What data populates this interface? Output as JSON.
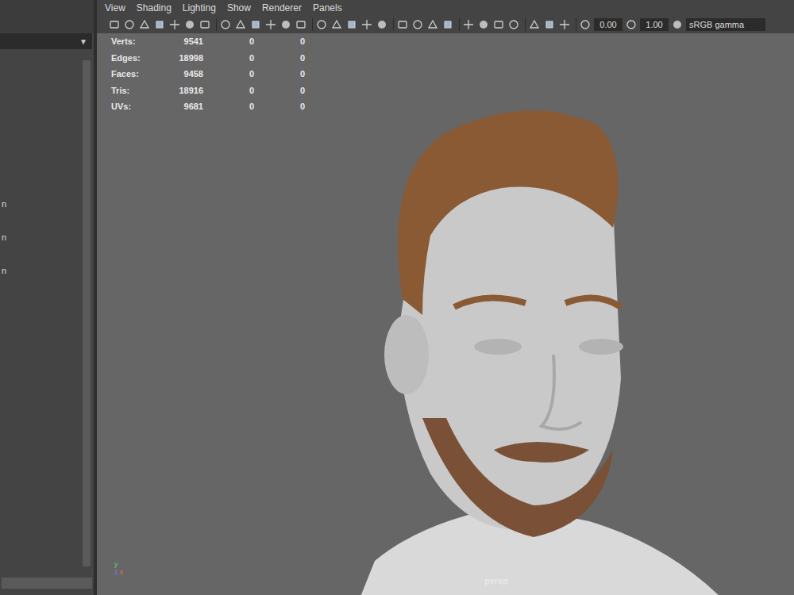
{
  "menu_bar": {
    "items": [
      "View",
      "Shading",
      "Lighting",
      "Show",
      "Renderer",
      "Panels"
    ]
  },
  "toolbar": {
    "fields": [
      {
        "label": "0.00"
      },
      {
        "label": "1.00"
      }
    ],
    "color_space": "sRGB gamma"
  },
  "outliner": {
    "dropdown_arrow": "▼",
    "items": [
      "n",
      "n",
      "n"
    ]
  },
  "hud": {
    "rows": [
      {
        "label": "Verts:",
        "values": [
          "9541",
          "0",
          "0"
        ]
      },
      {
        "label": "Edges:",
        "values": [
          "18998",
          "0",
          "0"
        ]
      },
      {
        "label": "Faces:",
        "values": [
          "9458",
          "0",
          "0"
        ]
      },
      {
        "label": "Tris:",
        "values": [
          "18916",
          "0",
          "0"
        ]
      },
      {
        "label": "UVs:",
        "values": [
          "9681",
          "0",
          "0"
        ]
      }
    ]
  },
  "axis": {
    "labels": [
      "y",
      "z",
      "x"
    ]
  },
  "camera": {
    "label": "persp"
  }
}
